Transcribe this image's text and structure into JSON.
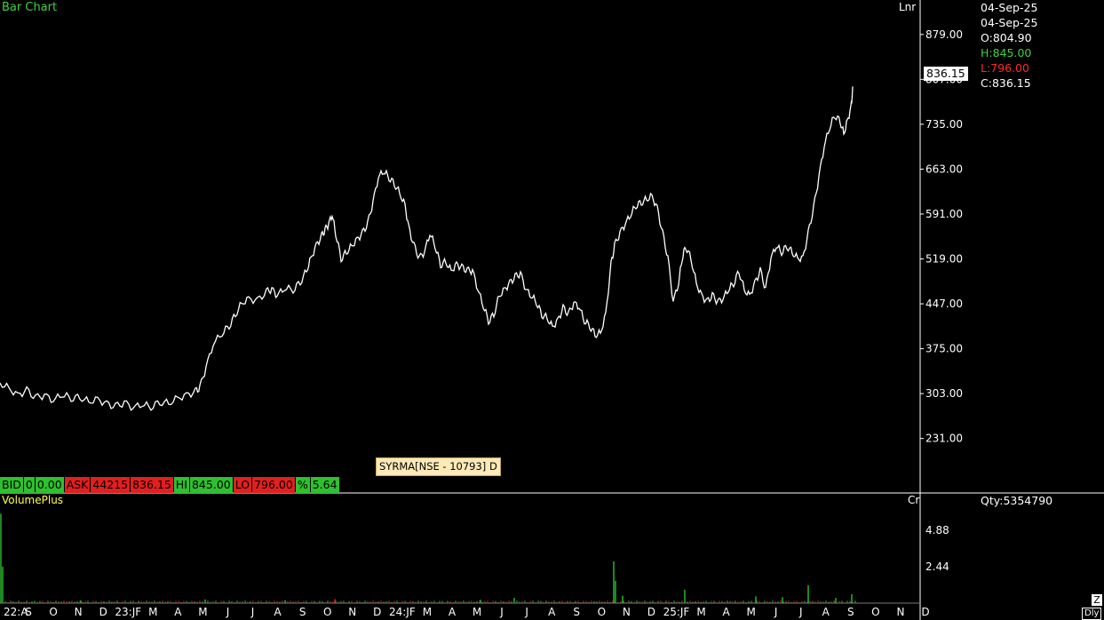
{
  "header": {
    "title": "Bar Chart",
    "scale_mode": "Lnr"
  },
  "info_panel": {
    "date1": "04-Sep-25",
    "date2": "04-Sep-25",
    "open": "O:804.90",
    "high": "H:845.00",
    "low": "L:796.00",
    "close": "C:836.15"
  },
  "last_price": "836.15",
  "tooltip": "SYRMA[NSE - 10793] D",
  "quote_bar": [
    {
      "text": "BID",
      "color": "green"
    },
    {
      "text": "0",
      "color": "green"
    },
    {
      "text": "0.00",
      "color": "green"
    },
    {
      "text": "ASK",
      "color": "red"
    },
    {
      "text": "44215",
      "color": "red"
    },
    {
      "text": "836.15",
      "color": "red"
    },
    {
      "text": "HI",
      "color": "green"
    },
    {
      "text": "845.00",
      "color": "green"
    },
    {
      "text": "LO",
      "color": "red"
    },
    {
      "text": "796.00",
      "color": "red"
    },
    {
      "text": "%",
      "color": "green"
    },
    {
      "text": "5.64",
      "color": "green"
    }
  ],
  "volume_panel": {
    "title": "VolumePlus",
    "scale_mode": "Cr",
    "qty": "Qty:5354790"
  },
  "corner": {
    "z": "Z",
    "dly": "Dly"
  },
  "colors": {
    "title_green": "#3fd23f",
    "up": "#2fc02f",
    "down": "#e02020",
    "volume_title": "#ffff4d"
  },
  "chart_data": {
    "type": "line",
    "price_axis": {
      "ticks": [
        231.0,
        303.0,
        375.0,
        447.0,
        519.0,
        591.0,
        663.0,
        735.0,
        807.0,
        879.0
      ],
      "labels": [
        "231.00",
        "303.00",
        "375.00",
        "447.00",
        "519.00",
        "591.00",
        "663.00",
        "735.00",
        "807.00",
        "879.00"
      ],
      "ylim": [
        165,
        920
      ]
    },
    "volume_axis": {
      "ticks": [
        2.44,
        4.88
      ],
      "labels": [
        "2.44",
        "4.88"
      ],
      "ylim": [
        0,
        6.2
      ]
    },
    "date_axis_labels": [
      "22:A",
      "S",
      "O",
      "N",
      "D",
      "23:JF",
      "M",
      "A",
      "M",
      "J",
      "J",
      "A",
      "S",
      "O",
      "N",
      "D",
      "24:JF",
      "M",
      "A",
      "M",
      "J",
      "J",
      "A",
      "S",
      "O",
      "N",
      "D",
      "25:JF",
      "M",
      "A",
      "M",
      "J",
      "J",
      "A",
      "S",
      "O",
      "N",
      "D"
    ],
    "close_series": {
      "x": [
        0,
        10,
        20,
        30,
        40,
        50,
        60,
        70,
        80,
        90,
        100,
        110,
        120,
        130,
        140,
        150,
        160,
        170,
        180,
        190,
        200,
        210,
        220,
        225,
        232,
        240,
        250,
        258,
        265,
        272,
        280,
        290,
        300,
        306,
        312,
        320,
        330,
        338,
        345,
        350,
        356,
        362,
        366,
        370,
        374,
        378,
        384,
        390,
        396,
        402,
        408,
        414,
        420,
        426,
        432,
        438,
        444,
        450,
        456,
        460,
        466,
        472,
        478,
        484,
        490,
        496,
        502,
        508,
        514,
        520,
        526,
        532,
        538,
        544,
        550,
        556,
        562,
        568,
        574,
        580,
        586,
        592,
        598,
        604,
        610,
        616,
        622,
        628,
        634,
        640,
        646,
        652,
        658,
        664,
        670,
        676,
        682,
        688,
        692,
        698,
        704,
        710,
        716,
        722,
        728,
        734,
        740,
        746,
        752,
        758,
        764,
        768,
        772,
        778,
        784,
        790,
        796,
        802,
        808,
        814,
        820,
        826,
        832,
        838,
        844,
        850,
        856,
        862,
        868,
        874,
        880,
        886,
        892,
        898,
        904,
        910,
        916,
        922,
        928,
        934,
        940,
        946,
        950,
        954,
        958,
        960
      ],
      "y": [
        320,
        312,
        300,
        308,
        296,
        300,
        292,
        302,
        296,
        298,
        290,
        294,
        286,
        282,
        288,
        280,
        286,
        282,
        290,
        288,
        296,
        300,
        306,
        312,
        345,
        382,
        400,
        412,
        430,
        448,
        455,
        452,
        466,
        470,
        460,
        472,
        470,
        482,
        500,
        520,
        540,
        555,
        565,
        575,
        590,
        560,
        520,
        530,
        540,
        550,
        560,
        575,
        610,
        650,
        660,
        650,
        640,
        625,
        605,
        570,
        540,
        520,
        530,
        560,
        540,
        510,
        515,
        500,
        510,
        505,
        500,
        500,
        470,
        445,
        420,
        430,
        460,
        470,
        480,
        490,
        495,
        470,
        460,
        450,
        430,
        425,
        410,
        420,
        440,
        430,
        448,
        442,
        420,
        412,
        398,
        400,
        430,
        510,
        540,
        560,
        575,
        590,
        605,
        610,
        615,
        620,
        600,
        560,
        520,
        450,
        480,
        520,
        540,
        520,
        480,
        460,
        450,
        460,
        450,
        455,
        470,
        480,
        500,
        470,
        460,
        480,
        500,
        470,
        520,
        540,
        530,
        540,
        530,
        520,
        520,
        560,
        600,
        650,
        700,
        730,
        750,
        740,
        720,
        740,
        760,
        790,
        830
      ]
    },
    "volume_series": {
      "x": [
        0,
        2,
        90,
        230,
        320,
        376,
        540,
        578,
        690,
        692,
        700,
        770,
        850,
        880,
        909,
        940,
        958
      ],
      "values": [
        6.0,
        2.44,
        0.18,
        0.25,
        0.2,
        0.28,
        0.22,
        0.35,
        2.8,
        1.5,
        0.5,
        0.9,
        0.45,
        0.4,
        1.2,
        0.35,
        0.6
      ],
      "colors": [
        "green",
        "green",
        "green",
        "green",
        "green",
        "red",
        "green",
        "green",
        "green",
        "green",
        "green",
        "green",
        "green",
        "green",
        "green",
        "green",
        "green"
      ]
    }
  }
}
